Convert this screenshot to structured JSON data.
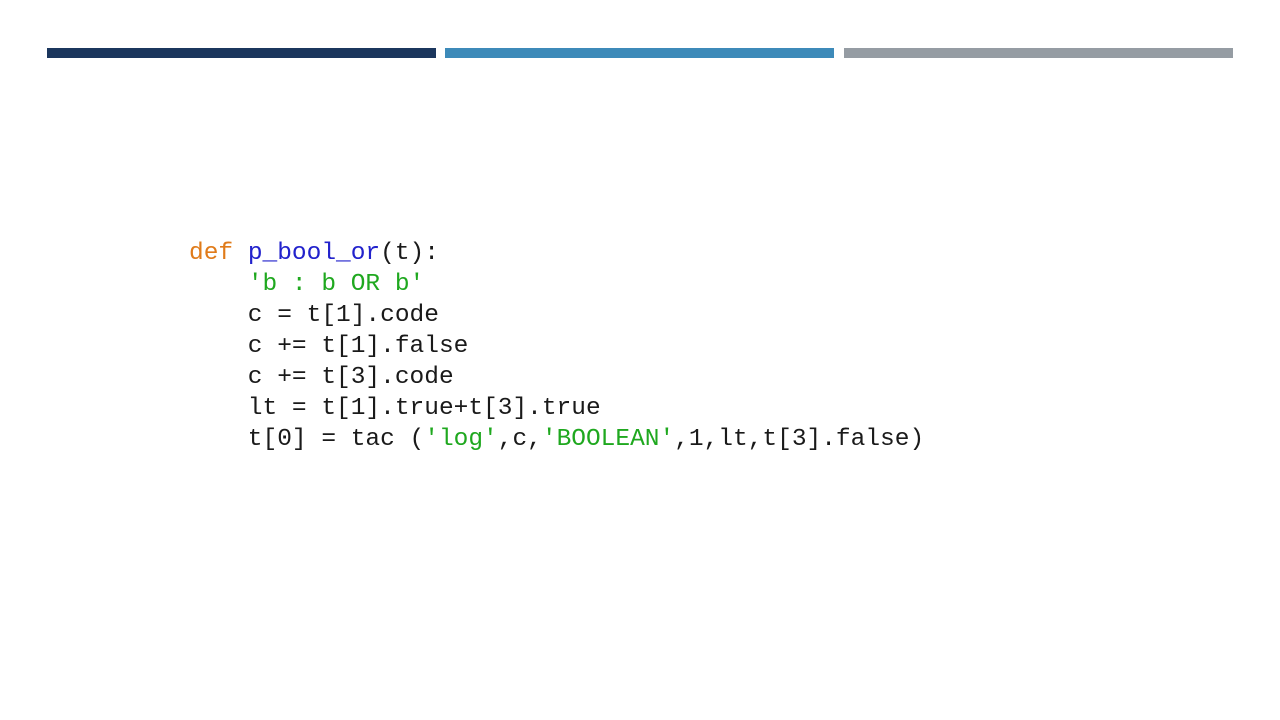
{
  "accent_bars": [
    {
      "color": "#1b365d"
    },
    {
      "color": "#3d8ab9"
    },
    {
      "color": "#959ca3"
    }
  ],
  "colors": {
    "keyword": "#e07b1a",
    "function_name": "#2222cc",
    "string": "#1fa81f",
    "plain": "#1a1a1a"
  },
  "code": {
    "lines": [
      [
        {
          "type": "keyword",
          "text": "def"
        },
        {
          "type": "plain",
          "text": " "
        },
        {
          "type": "func",
          "text": "p_bool_or"
        },
        {
          "type": "plain",
          "text": "(t):"
        }
      ],
      [
        {
          "type": "plain",
          "text": "    "
        },
        {
          "type": "string",
          "text": "'b : b OR b'"
        }
      ],
      [
        {
          "type": "plain",
          "text": "    c = t[1].code"
        }
      ],
      [
        {
          "type": "plain",
          "text": "    c += t[1].false"
        }
      ],
      [
        {
          "type": "plain",
          "text": "    c += t[3].code"
        }
      ],
      [
        {
          "type": "plain",
          "text": "    lt = t[1].true+t[3].true"
        }
      ],
      [
        {
          "type": "plain",
          "text": "    t[0] = tac ("
        },
        {
          "type": "string",
          "text": "'log'"
        },
        {
          "type": "plain",
          "text": ",c,"
        },
        {
          "type": "string",
          "text": "'BOOLEAN'"
        },
        {
          "type": "plain",
          "text": ",1,lt,t[3].false)"
        }
      ]
    ]
  }
}
